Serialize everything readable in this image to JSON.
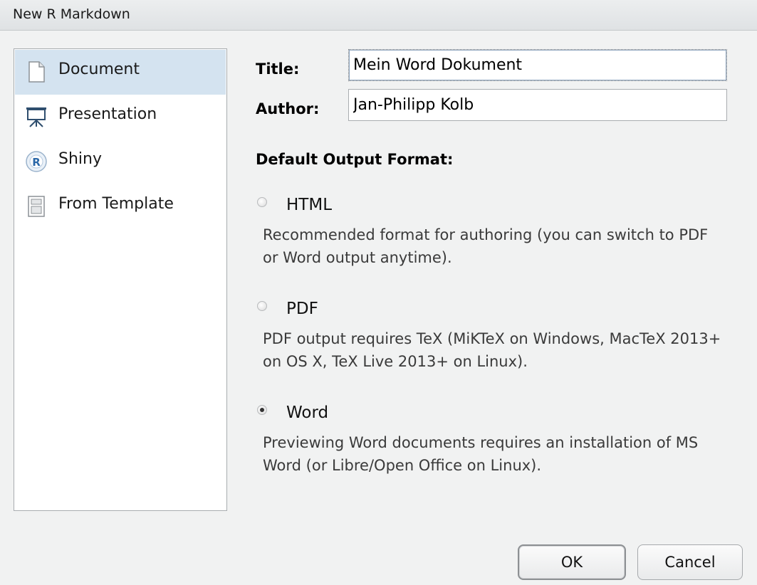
{
  "window": {
    "title": "New R Markdown"
  },
  "sidebar": {
    "items": [
      {
        "label": "Document",
        "icon": "document-icon",
        "selected": true
      },
      {
        "label": "Presentation",
        "icon": "presentation-icon",
        "selected": false
      },
      {
        "label": "Shiny",
        "icon": "shiny-icon",
        "selected": false
      },
      {
        "label": "From Template",
        "icon": "template-icon",
        "selected": false
      }
    ]
  },
  "form": {
    "title_label": "Title:",
    "title_value": "Mein Word Dokument",
    "author_label": "Author:",
    "author_value": "Jan-Philipp Kolb",
    "output_heading": "Default Output Format:"
  },
  "output_options": [
    {
      "label": "HTML",
      "description": "Recommended format for authoring (you can switch to PDF or Word output anytime).",
      "checked": false
    },
    {
      "label": "PDF",
      "description": "PDF output requires TeX (MiKTeX on Windows, MacTeX 2013+ on OS X, TeX Live 2013+ on Linux).",
      "checked": false
    },
    {
      "label": "Word",
      "description": "Previewing Word documents requires an installation of MS Word (or Libre/Open Office on Linux).",
      "checked": true
    }
  ],
  "buttons": {
    "ok_label": "OK",
    "cancel_label": "Cancel"
  },
  "colors": {
    "selected_item_bg": "#d4e3f0",
    "dialog_bg": "#f1f2f2"
  }
}
